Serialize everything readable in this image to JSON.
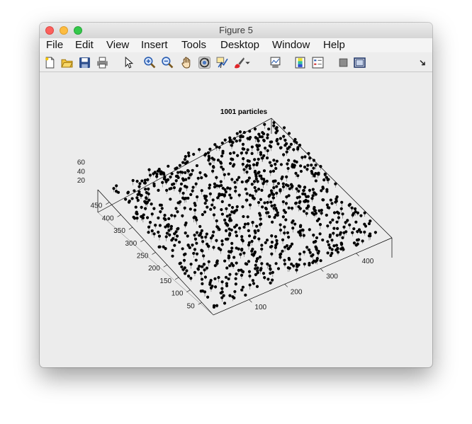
{
  "window": {
    "title": "Figure 5"
  },
  "menu": [
    "File",
    "Edit",
    "View",
    "Insert",
    "Tools",
    "Desktop",
    "Window",
    "Help"
  ],
  "toolbar": [
    "new-figure-icon",
    "open-file-icon",
    "save-icon",
    "print-icon",
    "pointer-icon",
    "zoom-in-icon",
    "zoom-out-icon",
    "pan-hand-icon",
    "rotate-3d-icon",
    "data-cursor-icon",
    "brush-icon",
    "brush-dropdown-icon",
    "link-plot-icon",
    "colorbar-icon",
    "legend-icon",
    "hide-plot-tools-icon",
    "show-plot-tools-icon",
    "dock-icon"
  ],
  "chart_data": {
    "type": "scatter",
    "title": "1001 particles",
    "num_points": 1001,
    "x_ticks": [
      "100",
      "200",
      "300",
      "400"
    ],
    "y_ticks": [
      "50",
      "100",
      "150",
      "200",
      "250",
      "300",
      "350",
      "400",
      "450"
    ],
    "z_ticks": [
      "20",
      "40",
      "60"
    ],
    "xlim": [
      0,
      500
    ],
    "ylim": [
      0,
      500
    ],
    "zlim": [
      0,
      70
    ],
    "marker_color": "#000000"
  }
}
